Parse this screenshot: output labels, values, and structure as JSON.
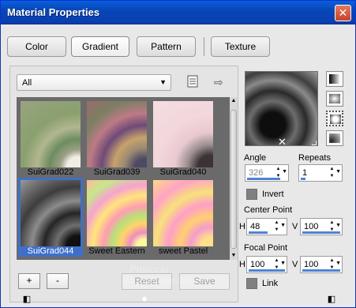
{
  "window": {
    "title": "Material Properties",
    "close_icon": "close-icon"
  },
  "tabs": [
    {
      "label": "Color"
    },
    {
      "label": "Gradient"
    },
    {
      "label": "Pattern"
    },
    {
      "label": "Texture"
    }
  ],
  "category_select": {
    "value": "All"
  },
  "gradients": [
    {
      "label": "SuiGrad022"
    },
    {
      "label": "SuiGrad039"
    },
    {
      "label": "SuiGrad040"
    },
    {
      "label": "SuiGrad044",
      "selected": true
    },
    {
      "label": "Sweet Eastern"
    },
    {
      "label": "sweet  Pastel"
    }
  ],
  "buttons": {
    "add": "+",
    "remove": "-",
    "reset": "Reset",
    "save": "Save"
  },
  "angle": {
    "label": "Angle",
    "value": "326"
  },
  "repeats": {
    "label": "Repeats",
    "value": "1"
  },
  "invert": {
    "label": "Invert"
  },
  "center_point": {
    "label": "Center Point",
    "h_label": "H",
    "h_value": "48",
    "v_label": "V",
    "v_value": "100"
  },
  "focal_point": {
    "label": "Focal Point",
    "h_label": "H",
    "h_value": "100",
    "v_label": "V",
    "v_value": "100"
  },
  "link": {
    "label": "Link"
  },
  "watermark": {
    "line1": "Pinuccia",
    "line2": "www.maidiregrafica.eu"
  },
  "colors": {
    "accent": "#3f6fc9",
    "titlebar": "#0846b8"
  }
}
